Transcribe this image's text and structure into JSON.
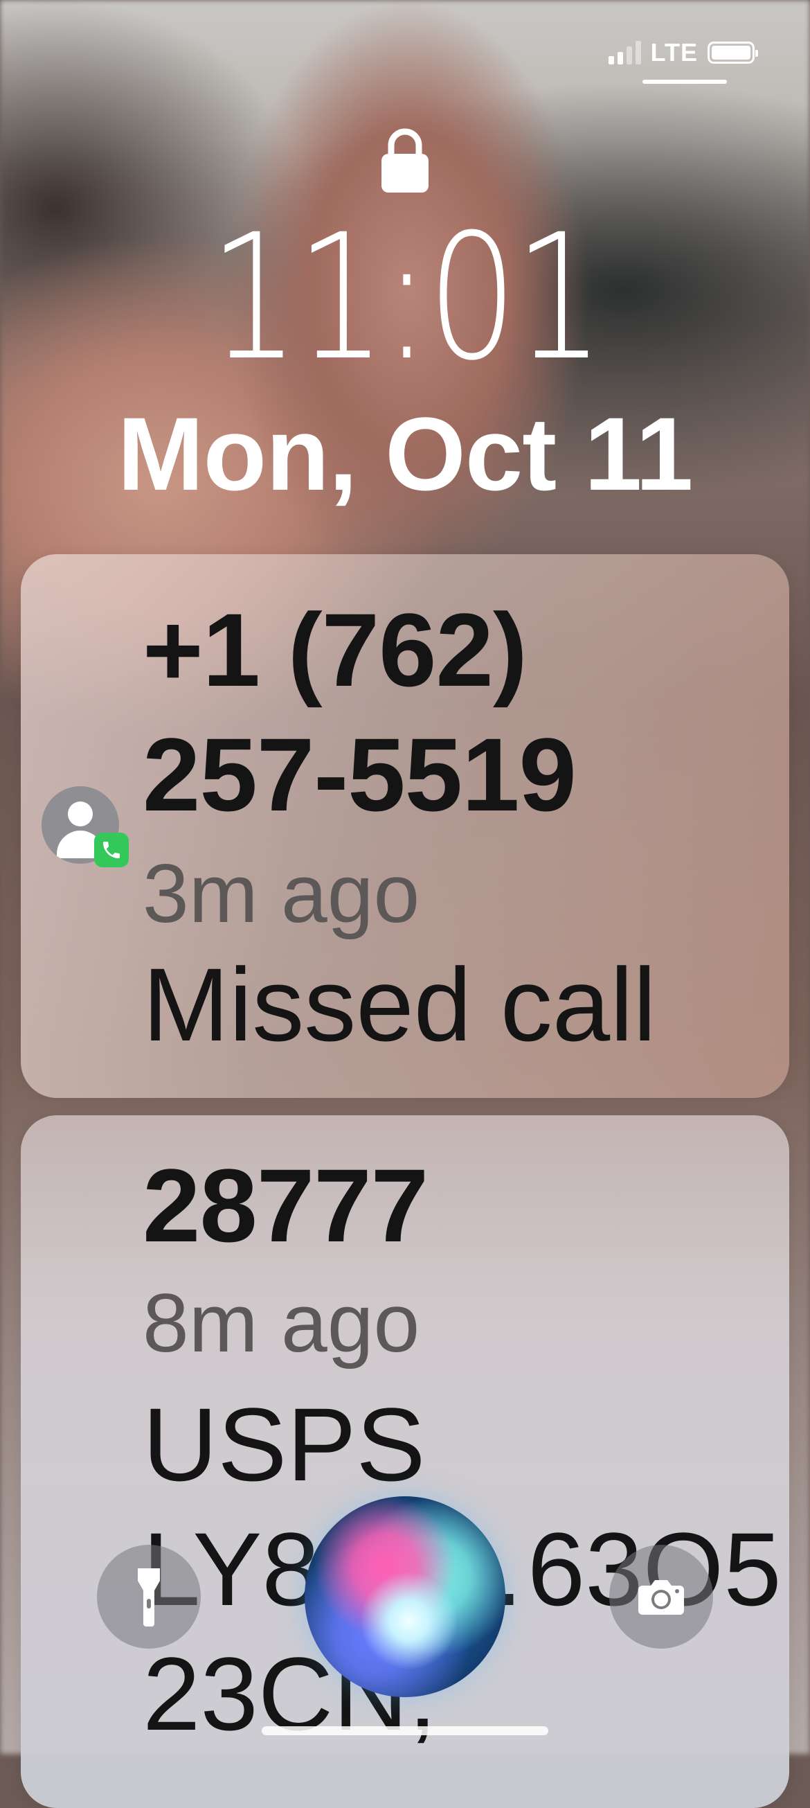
{
  "status_bar": {
    "network": "LTE"
  },
  "lock_screen": {
    "time": "11:01",
    "date": "Mon, Oct 11"
  },
  "notifications": [
    {
      "title_line1": "+1 (762)",
      "title_line2": "257-5519",
      "age": "3m ago",
      "body": "Missed call",
      "icon": "contact-avatar-icon",
      "badge_icon": "phone-icon"
    },
    {
      "title": "28777",
      "age": "8m ago",
      "body_line1": "USPS",
      "body_line2": "LY8……63O5",
      "body_line3": "23CN,"
    }
  ],
  "buttons": {
    "left": "flashlight-icon",
    "right": "camera-icon"
  },
  "colors": {
    "accent_green": "#34c759",
    "text_dark": "#141414",
    "text_secondary": "#5d5858"
  }
}
